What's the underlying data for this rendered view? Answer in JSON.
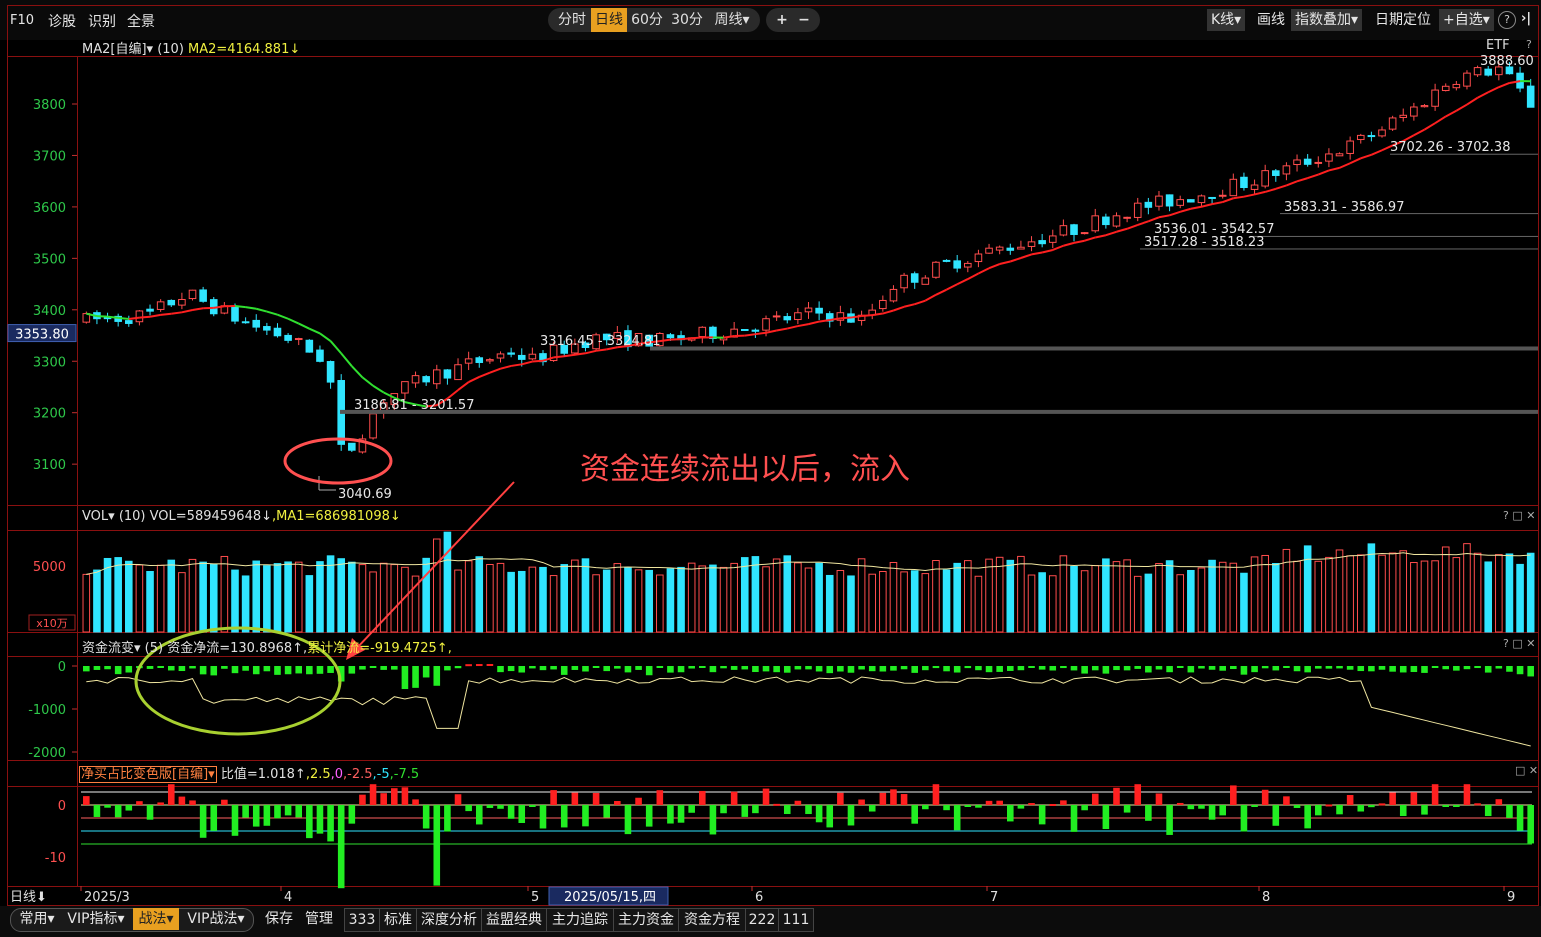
{
  "topbar": {
    "f10": "F10",
    "diagnose": "诊股",
    "recognize": "识别",
    "fullscreen": "全景",
    "periods": [
      "分时",
      "日线",
      "60分",
      "30分",
      "周线▾"
    ],
    "zoom_in": "+",
    "zoom_out": "−",
    "kline": "K线▾",
    "draw": "画线",
    "overlay": "指数叠加▾",
    "date_locate": "日期定位",
    "watchlist": "+自选▾",
    "help": "?",
    "collapse": "›|"
  },
  "main_panel": {
    "indicator": "MA2[自编]▾",
    "param": "(10)",
    "value_label": "MA2=4164.881↓",
    "badge": "ETF",
    "qmark": "?",
    "y_ticks": [
      "3800",
      "3700",
      "3600",
      "3500",
      "3400",
      "3300",
      "3200",
      "3100"
    ],
    "current_price": "3353.80",
    "price_labels": [
      "3888.60",
      "3702.26 - 3702.38",
      "3583.31 - 3586.97",
      "3536.01 - 3542.57",
      "3517.28 - 3518.23",
      "3316.45 - 3324.81",
      "3186.81 - 3201.57",
      "3040.69"
    ]
  },
  "vol_panel": {
    "indicator": "VOL▾",
    "param": "(10)",
    "vol": "VOL=589459648↓",
    "ma1": ",MA1=686981098↓",
    "y_tick": "5000",
    "unit": "x10万",
    "controls": "? □ ✕"
  },
  "fund_panel": {
    "indicator": "资金流变▾",
    "param": "(5)",
    "net": "资金净流=130.8968↑,",
    "cum": "累计净流=-919.4725↑,",
    "y_ticks": [
      "0",
      "-1000",
      "-2000"
    ],
    "controls": "? □ ✕"
  },
  "ratio_panel": {
    "indicator": "净买占比变色版[自编]▾",
    "ratio": "比值=1.018↑",
    "levels": [
      ",2.5",
      ",0",
      ",-2.5",
      ",-5",
      ",-7.5"
    ],
    "y_ticks": [
      "0",
      "-10"
    ],
    "controls": "□ ✕"
  },
  "time_axis": {
    "period": "日线⬇",
    "labels": [
      "2025/3",
      "4",
      "5",
      "2025/05/15,四",
      "6",
      "7",
      "8",
      "9"
    ]
  },
  "annotation": "资金连续流出以后，流入",
  "bottombar": {
    "items": [
      "常用▾",
      "VIP指标▾",
      "战法▾",
      "VIP战法▾",
      "保存",
      "管理",
      "333",
      "标准",
      "深度分析",
      "益盟经典",
      "主力追踪",
      "主力资金",
      "资金方程",
      "222",
      "111"
    ]
  },
  "colors": {
    "up": "#ff4d4d",
    "down": "#30e5ff",
    "ma_red": "#ff2020",
    "ma_green": "#30e030",
    "fund_green": "#22ee22",
    "annot": "#ff5050",
    "circle_red": "#ff5050",
    "circle_yg": "#a8d030"
  }
}
